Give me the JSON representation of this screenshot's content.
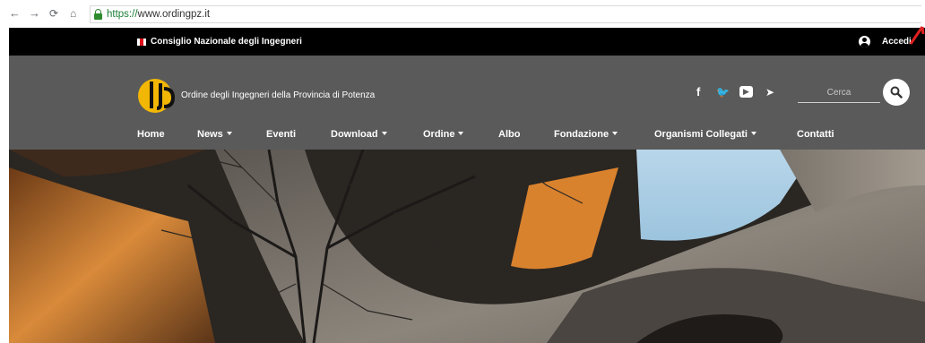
{
  "browser": {
    "back_icon": "arrow-left-icon",
    "forward_icon": "arrow-right-icon",
    "reload_icon": "reload-icon",
    "home_icon": "home-icon",
    "url_protocol": "https://",
    "url_host": "www.ordingpz.it"
  },
  "topbar": {
    "cni_label": "Consiglio Nazionale degli Ingegneri",
    "login_label": "Accedi",
    "flag_colors": [
      "#ffffff",
      "#e0101a",
      "#ffffff"
    ]
  },
  "header": {
    "org_name": "Ordine degli Ingegneri della Provincia di Potenza",
    "social": [
      {
        "icon": "facebook-icon",
        "glyph": "f"
      },
      {
        "icon": "twitter-icon",
        "glyph": "🐦"
      },
      {
        "icon": "youtube-icon",
        "glyph": "▶"
      },
      {
        "icon": "telegram-icon",
        "glyph": "➤"
      }
    ],
    "search_placeholder": "Cerca"
  },
  "nav": {
    "items": [
      {
        "label": "Home",
        "dropdown": false
      },
      {
        "label": "News",
        "dropdown": true
      },
      {
        "label": "Eventi",
        "dropdown": false
      },
      {
        "label": "Download",
        "dropdown": true
      },
      {
        "label": "Ordine",
        "dropdown": true
      },
      {
        "label": "Albo",
        "dropdown": false
      },
      {
        "label": "Fondazione",
        "dropdown": true
      },
      {
        "label": "Organismi Collegati",
        "dropdown": true
      },
      {
        "label": "Contatti",
        "dropdown": false
      }
    ]
  },
  "colors": {
    "topbar_bg": "#000000",
    "header_bg": "#5a5a5a",
    "logo_yellow": "#f2b705",
    "annotation_red": "#e02020"
  }
}
